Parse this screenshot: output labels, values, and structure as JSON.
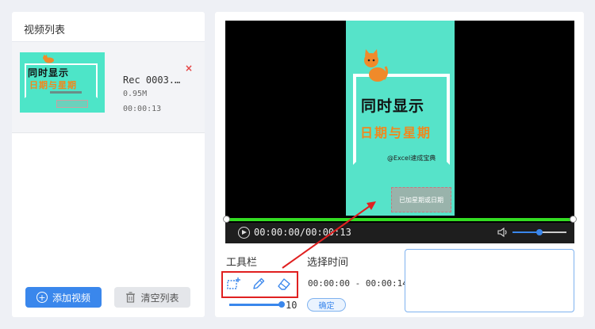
{
  "left_panel": {
    "title": "视频列表",
    "video": {
      "name": "Rec 0003.…",
      "size": "0.95M",
      "duration": "00:00:13",
      "thumbnail_text_line1": "同时显示",
      "thumbnail_text_line2": "日期与星期",
      "close_symbol": "×"
    },
    "add_button": "添加视频",
    "clear_button": "清空列表"
  },
  "player": {
    "frame_text_line1": "同时显示",
    "frame_text_line2": "日期与星期",
    "frame_handle": "@Excel速成宝典",
    "stamp_text": "已加星期或日期",
    "time_display": "00:00:00/00:00:13",
    "volume_level": 0.5
  },
  "toolbar": {
    "label": "工具栏",
    "tools": [
      "crop-icon",
      "pencil-icon",
      "eraser-icon"
    ],
    "brush_size": "10",
    "brush_fraction": 0.95
  },
  "time_select": {
    "label": "选择时间",
    "range": "00:00:00 - 00:00:14",
    "confirm": "确定"
  },
  "colors": {
    "accent": "#3a87ec",
    "highlight": "#e02020",
    "timeline": "#33dd22",
    "frame_bg": "#56e3c9"
  }
}
